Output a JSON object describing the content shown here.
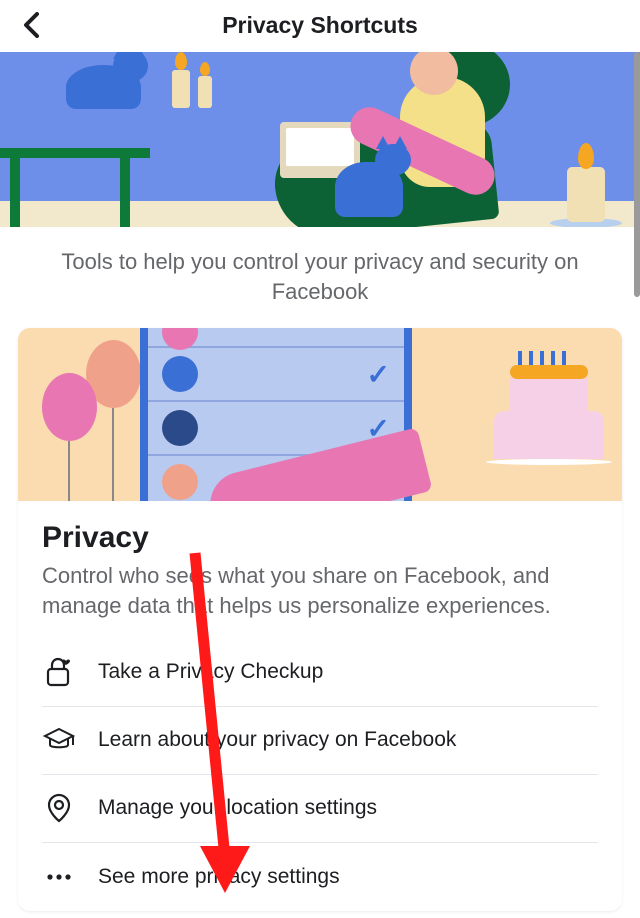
{
  "header": {
    "title": "Privacy Shortcuts"
  },
  "subtitle": "Tools to help you control your privacy and security on Facebook",
  "card": {
    "title": "Privacy",
    "description": "Control who sees what you share on Facebook, and manage data that helps us personalize experiences.",
    "items": [
      {
        "icon": "lock-heart",
        "label": "Take a Privacy Checkup"
      },
      {
        "icon": "grad-cap",
        "label": "Learn about your privacy on Facebook"
      },
      {
        "icon": "location-pin",
        "label": "Manage your location settings"
      },
      {
        "icon": "dots",
        "label": "See more privacy settings"
      }
    ]
  }
}
